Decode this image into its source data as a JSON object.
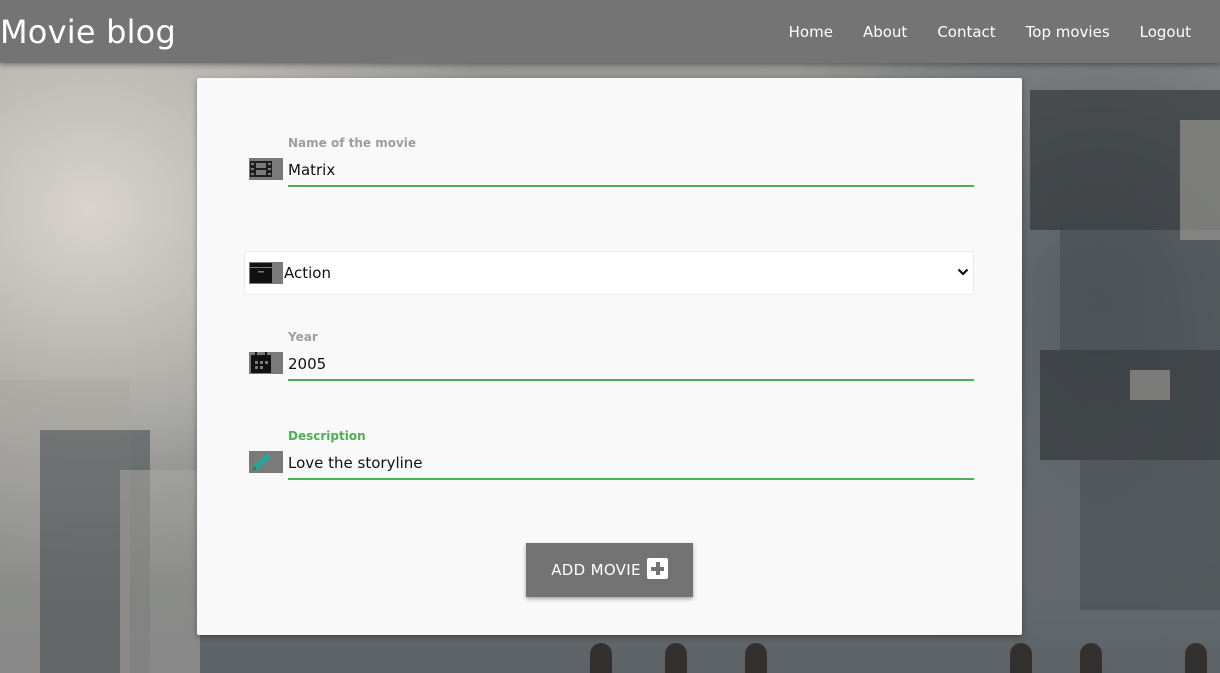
{
  "navbar": {
    "brand": "Movie blog",
    "links": [
      "Home",
      "About",
      "Contact",
      "Top movies",
      "Logout"
    ]
  },
  "form": {
    "name": {
      "label": "Name of the movie",
      "value": "Matrix",
      "icon": "film-icon"
    },
    "genre": {
      "value": "Action",
      "icon": "folder-icon",
      "chevron": "chevron-down-icon"
    },
    "year": {
      "label": "Year",
      "value": "2005",
      "icon": "calendar-icon"
    },
    "description": {
      "label": "Description",
      "value": "Love the storyline",
      "icon": "pencil-icon"
    },
    "submit": {
      "label": "ADD MOVIE",
      "icon": "plus-square-icon"
    }
  },
  "colors": {
    "navbar": "#747474",
    "accent_green": "#4caf50",
    "button": "#737373",
    "card": "#f9f9f9"
  }
}
